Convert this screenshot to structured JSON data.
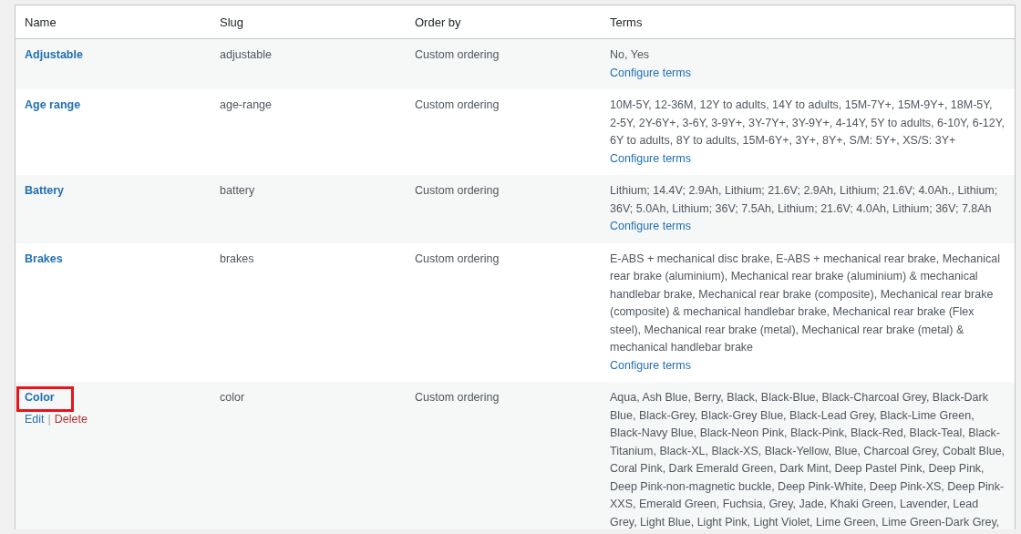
{
  "table": {
    "columns": [
      "Name",
      "Slug",
      "Order by",
      "Terms"
    ],
    "rows": [
      {
        "name": "Adjustable",
        "slug": "adjustable",
        "order_by": "Custom ordering",
        "terms": "No, Yes",
        "configure": "Configure terms",
        "highlighted": false
      },
      {
        "name": "Age range",
        "slug": "age-range",
        "order_by": "Custom ordering",
        "terms": "10M-5Y, 12-36M, 12Y to adults, 14Y to adults, 15M-7Y+, 15M-9Y+, 18M-5Y, 2-5Y, 2Y-6Y+, 3-6Y, 3-9Y+, 3Y-7Y+, 3Y-9Y+, 4-14Y, 5Y to adults, 6-10Y, 6-12Y, 6Y to adults, 8Y to adults, 15M-6Y+, 3Y+, 8Y+, S/M: 5Y+, XS/S: 3Y+",
        "configure": "Configure terms",
        "highlighted": false
      },
      {
        "name": "Battery",
        "slug": "battery",
        "order_by": "Custom ordering",
        "terms": "Lithium; 14.4V; 2.9Ah, Lithium; 21.6V; 2.9Ah, Lithium; 21.6V; 4.0Ah., Lithium; 36V; 5.0Ah, Lithium; 36V; 7.5Ah, Lithium; 21.6V; 4.0Ah, Lithium; 36V; 7.8Ah",
        "configure": "Configure terms",
        "highlighted": false
      },
      {
        "name": "Brakes",
        "slug": "brakes",
        "order_by": "Custom ordering",
        "terms": "E-ABS + mechanical disc brake, E-ABS + mechanical rear brake, Mechanical rear brake (aluminium), Mechanical rear brake (aluminium) & mechanical handlebar brake, Mechanical rear brake (composite), Mechanical rear brake (composite) & mechanical handlebar brake, Mechanical rear brake (Flex steel), Mechanical rear brake (metal), Mechanical rear brake (metal) & mechanical handlebar brake",
        "configure": "Configure terms",
        "highlighted": false
      },
      {
        "name": "Color",
        "slug": "color",
        "order_by": "Custom ordering",
        "terms": "Aqua, Ash Blue, Berry, Black, Black-Blue, Black-Charcoal Grey, Black-Dark Blue, Black-Grey, Black-Grey Blue, Black-Lead Grey, Black-Lime Green, Black-Navy Blue, Black-Neon Pink, Black-Pink, Black-Red, Black-Teal, Black-Titanium, Black-XL, Black-XS, Black-Yellow, Blue, Charcoal Grey, Cobalt Blue, Coral Pink, Dark Emerald Green, Dark Mint, Deep Pastel Pink, Deep Pink, Deep Pink-non-magnetic buckle, Deep Pink-White, Deep Pink-XS, Deep Pink-XXS, Emerald Green, Fuchsia, Grey, Jade, Khaki Green, Lavender, Lead Grey, Light Blue, Light Pink, Light Violet, Lime Green, Lime Green-Dark Grey,",
        "highlighted": true,
        "action_separator": "|",
        "actions": [
          {
            "label": "Edit",
            "kind": "edit"
          },
          {
            "label": "Delete",
            "kind": "delete"
          }
        ]
      }
    ]
  }
}
